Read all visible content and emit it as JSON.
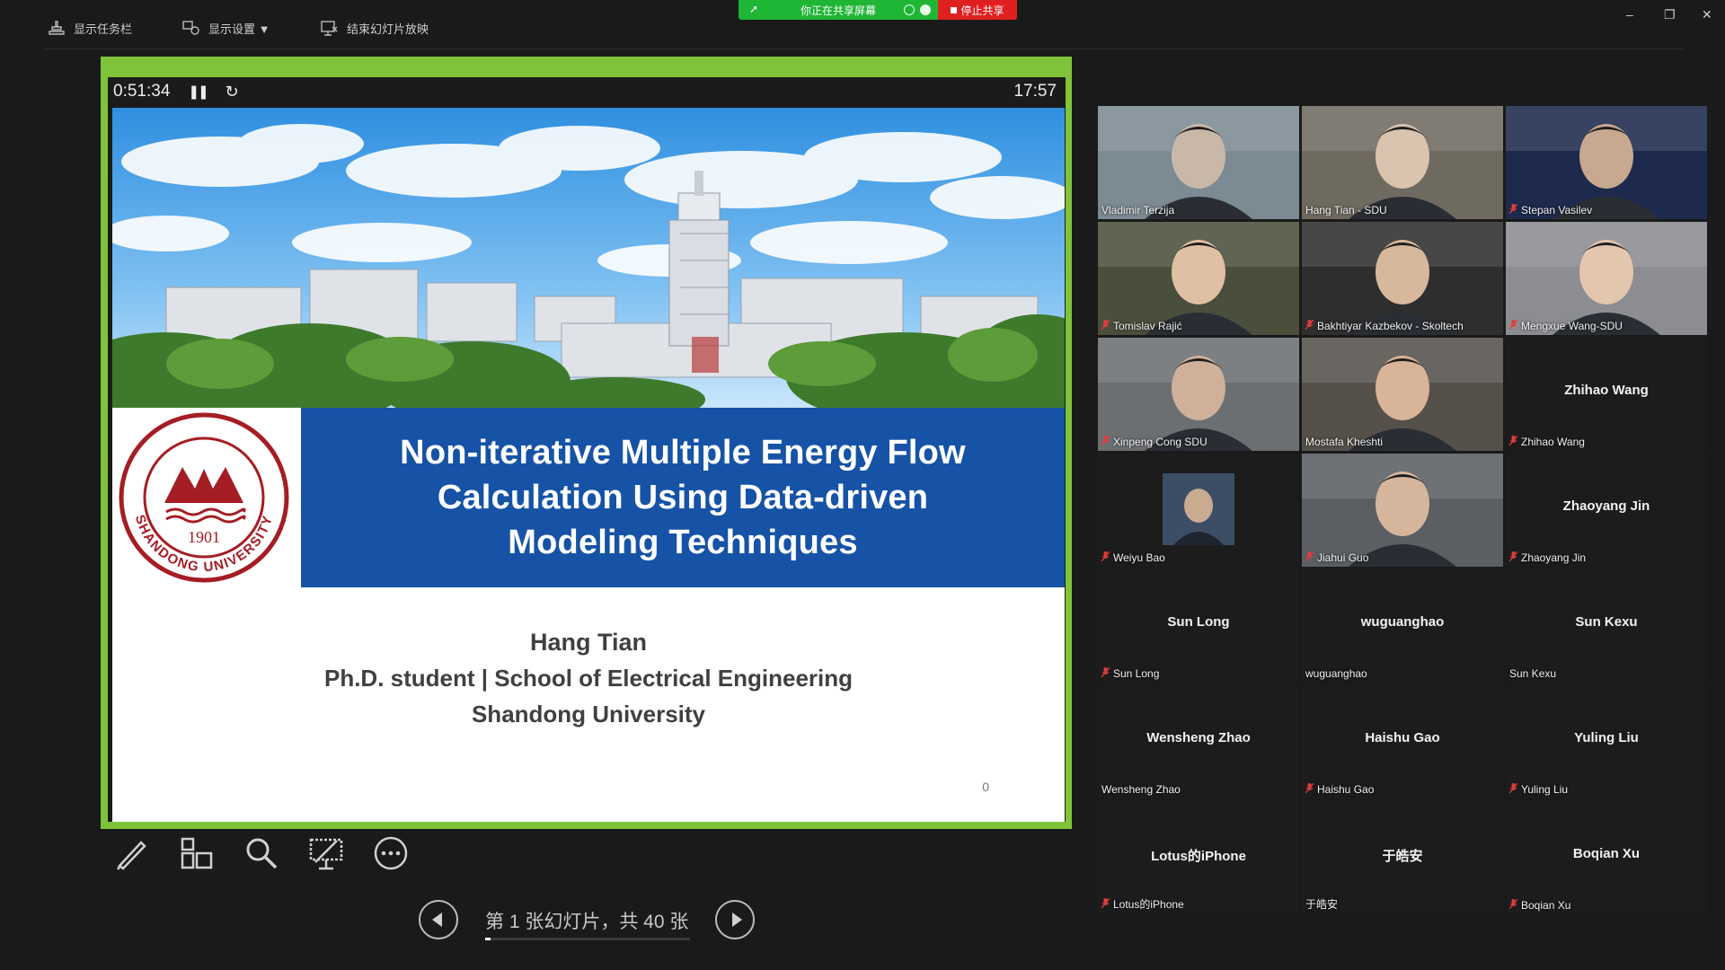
{
  "topbar": {
    "show_taskbar": "显示任务栏",
    "display_settings": "显示设置 ▼",
    "end_slideshow": "结束幻灯片放映",
    "sharing_status": "你正在共享屏幕",
    "stop_share": "停止共享",
    "minimize": "–",
    "restore": "❐",
    "close": "✕"
  },
  "presenter": {
    "elapsed": "0:51:34",
    "clock": "17:57",
    "accent_color": "#7fc33b"
  },
  "slide": {
    "title_lines": [
      "Non-iterative Multiple Energy Flow",
      "Calculation Using Data-driven",
      "Modeling Techniques"
    ],
    "logo_year": "1901",
    "logo_text": "SHANDONG UNIVERSITY",
    "author": "Hang Tian",
    "position": "Ph.D. student | School of Electrical Engineering",
    "affiliation": "Shandong University",
    "page_number": "0",
    "band_color": "#1653a6"
  },
  "navigation": {
    "counter": "第 1 张幻灯片，共 40 张",
    "current": 1,
    "total": 40
  },
  "participants": [
    {
      "name": "Vladimir Terzija",
      "muted": false,
      "video": true
    },
    {
      "name": "Hang Tian - SDU",
      "muted": false,
      "video": true
    },
    {
      "name": "Stepan Vasilev",
      "muted": true,
      "video": true
    },
    {
      "name": "Tomislav Rajić",
      "muted": true,
      "video": true
    },
    {
      "name": "Bakhtiyar Kazbekov - Skoltech",
      "muted": true,
      "video": true
    },
    {
      "name": "Mengxue Wang-SDU",
      "muted": true,
      "video": true
    },
    {
      "name": "Xinpeng Cong SDU",
      "muted": true,
      "video": true
    },
    {
      "name": "Mostafa Kheshti",
      "muted": false,
      "video": true,
      "active": true
    },
    {
      "name": "Zhihao Wang",
      "muted": true,
      "video": false,
      "display": "Zhihao Wang"
    },
    {
      "name": "Weiyu Bao",
      "muted": true,
      "video": true,
      "small": true
    },
    {
      "name": "Jiahui Guo",
      "muted": true,
      "video": true
    },
    {
      "name": "Zhaoyang Jin",
      "muted": true,
      "video": false,
      "display": "Zhaoyang Jin"
    },
    {
      "name": "Sun Long",
      "muted": true,
      "video": false,
      "display": "Sun Long"
    },
    {
      "name": "wuguanghao",
      "muted": false,
      "video": false,
      "display": "wuguanghao"
    },
    {
      "name": "Sun Kexu",
      "muted": false,
      "video": false,
      "display": "Sun Kexu"
    },
    {
      "name": "Wensheng Zhao",
      "muted": false,
      "video": false,
      "display": "Wensheng Zhao"
    },
    {
      "name": "Haishu Gao",
      "muted": true,
      "video": false,
      "display": "Haishu Gao"
    },
    {
      "name": "Yuling Liu",
      "muted": true,
      "video": false,
      "display": "Yuling Liu"
    },
    {
      "name": "Lotus的iPhone",
      "muted": true,
      "video": false,
      "display": "Lotus的iPhone"
    },
    {
      "name": "于皓安",
      "muted": false,
      "video": false,
      "display": "于皓安"
    },
    {
      "name": "Boqian Xu",
      "muted": true,
      "video": false,
      "display": "Boqian Xu"
    }
  ]
}
